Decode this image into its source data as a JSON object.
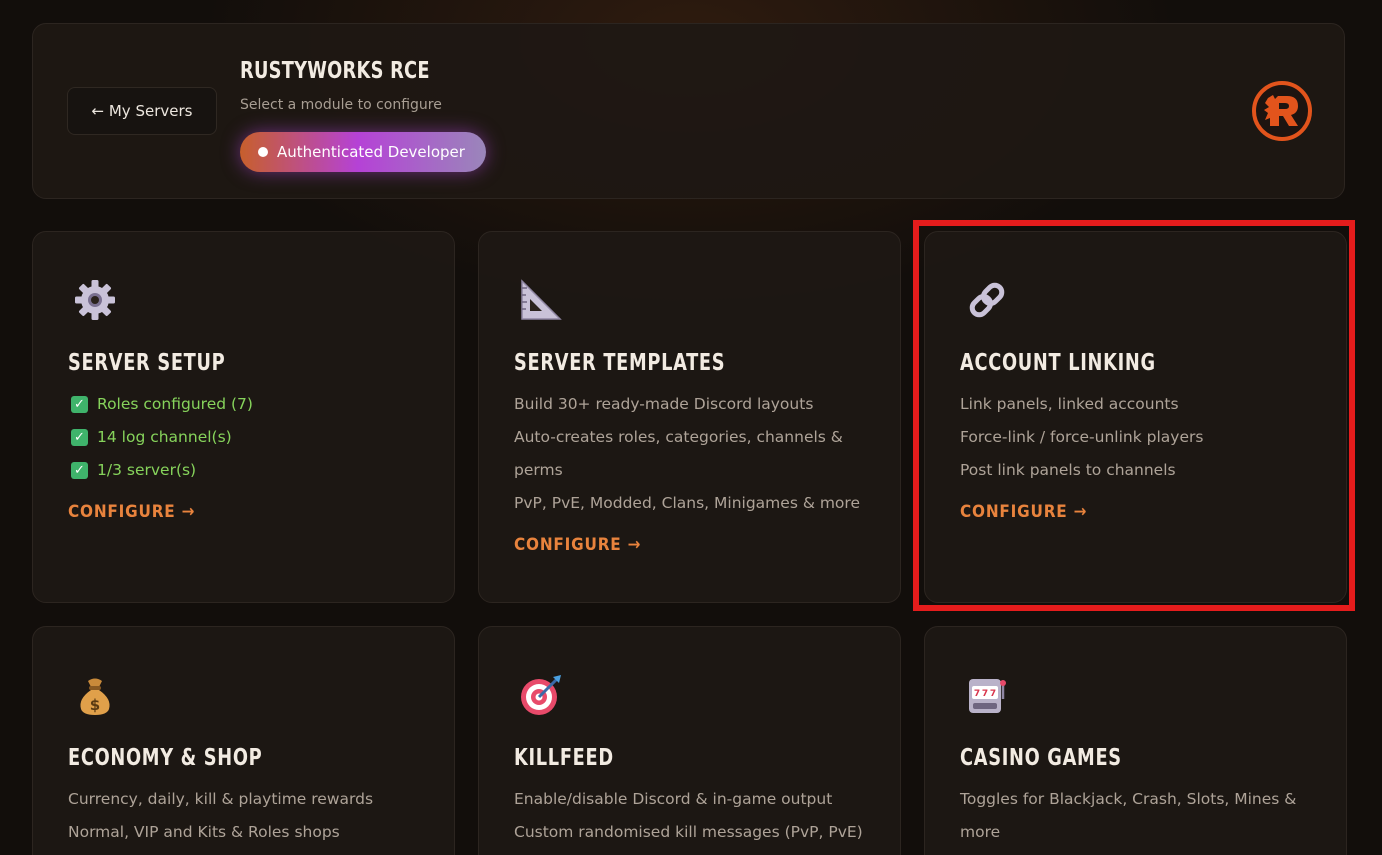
{
  "header": {
    "back_label": "← My Servers",
    "title": "RUSTYWORKS RCE",
    "subtitle": "Select a module to configure",
    "badge": "Authenticated Developer"
  },
  "cards": [
    {
      "title": "SERVER SETUP",
      "icon": "gear-icon",
      "checks": [
        "Roles configured (7)",
        "14 log channel(s)",
        "1/3 server(s)"
      ],
      "configure": "CONFIGURE →"
    },
    {
      "title": "SERVER TEMPLATES",
      "icon": "triangle-ruler-icon",
      "lines": [
        "Build 30+ ready-made Discord layouts",
        "Auto-creates roles, categories, channels & perms",
        "PvP, PvE, Modded, Clans, Minigames & more"
      ],
      "configure": "CONFIGURE →"
    },
    {
      "title": "ACCOUNT LINKING",
      "icon": "link-icon",
      "lines": [
        "Link panels, linked accounts",
        "Force-link / force-unlink players",
        "Post link panels to channels"
      ],
      "configure": "CONFIGURE →"
    },
    {
      "title": "ECONOMY & SHOP",
      "icon": "money-bag-icon",
      "lines": [
        "Currency, daily, kill & playtime rewards",
        "Normal, VIP and Kits & Roles shops"
      ]
    },
    {
      "title": "KILLFEED",
      "icon": "target-icon",
      "lines": [
        "Enable/disable Discord & in-game output",
        "Custom randomised kill messages (PvP, PvE)"
      ]
    },
    {
      "title": "CASINO GAMES",
      "icon": "slot-machine-icon",
      "lines": [
        "Toggles for Blackjack, Crash, Slots, Mines & more"
      ]
    }
  ],
  "colors": {
    "accent": "#e8833d",
    "check": "#86d35b",
    "highlight": "#e51c1c"
  }
}
